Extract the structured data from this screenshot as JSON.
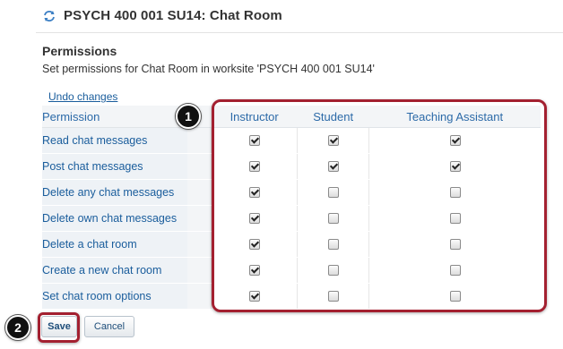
{
  "page": {
    "title": "PSYCH 400 001 SU14: Chat Room",
    "heading": "Permissions",
    "description": "Set permissions for Chat Room in worksite 'PSYCH 400 001 SU14'",
    "undo_label": "Undo changes"
  },
  "table": {
    "header": {
      "permission": "Permission",
      "roles": [
        "Instructor",
        "Student",
        "Teaching Assistant"
      ]
    },
    "rows": [
      {
        "label": "Read chat messages",
        "checks": [
          true,
          true,
          true
        ]
      },
      {
        "label": "Post chat messages",
        "checks": [
          true,
          true,
          true
        ]
      },
      {
        "label": "Delete any chat messages",
        "checks": [
          true,
          false,
          false
        ]
      },
      {
        "label": "Delete own chat messages",
        "checks": [
          true,
          false,
          false
        ]
      },
      {
        "label": "Delete a chat room",
        "checks": [
          true,
          false,
          false
        ]
      },
      {
        "label": "Create a new chat room",
        "checks": [
          true,
          false,
          false
        ]
      },
      {
        "label": "Set chat room options",
        "checks": [
          true,
          false,
          false
        ]
      }
    ]
  },
  "callouts": {
    "first": "1",
    "second": "2"
  },
  "buttons": {
    "save": "Save",
    "cancel": "Cancel"
  },
  "colors": {
    "accent": "#a32030",
    "link": "#1a5d9c"
  },
  "icons": {
    "tool": "refresh-arrows-icon"
  }
}
